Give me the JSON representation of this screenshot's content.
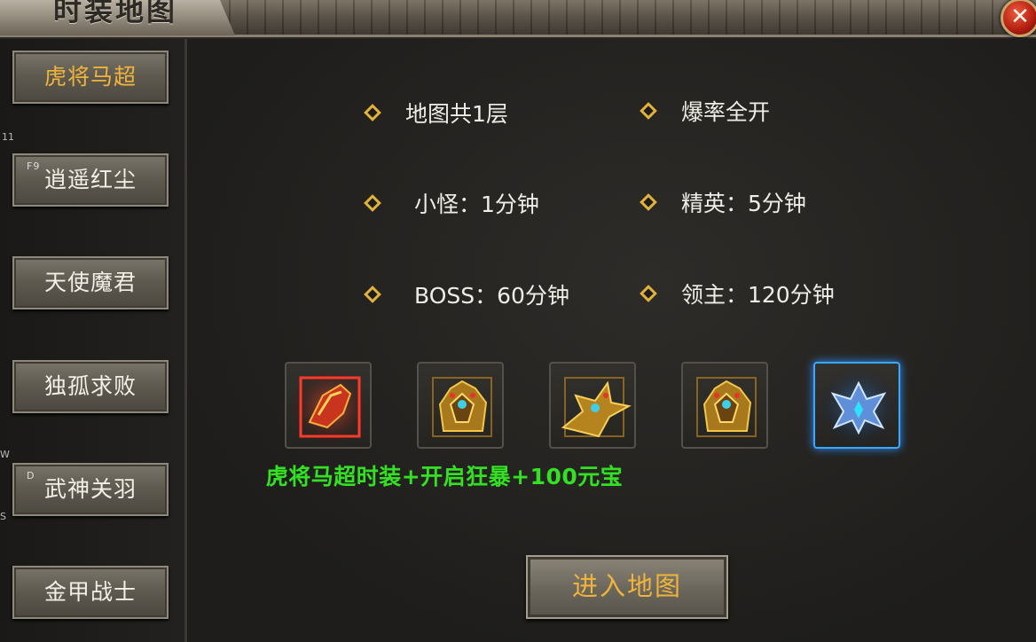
{
  "window": {
    "title": "时装地图"
  },
  "sidebar": {
    "items": [
      {
        "label": "虎将马超",
        "tag": ""
      },
      {
        "label": "逍遥红尘",
        "tag": "F9"
      },
      {
        "label": "天使魔君",
        "tag": ""
      },
      {
        "label": "独孤求败",
        "tag": ""
      },
      {
        "label": "武神关羽",
        "tag": "D"
      },
      {
        "label": "金甲战士",
        "tag": ""
      }
    ],
    "active_index": 0,
    "edge_labels": [
      "11",
      "W",
      "S"
    ]
  },
  "info": [
    {
      "text": "地图共1层"
    },
    {
      "text": "爆率全开"
    },
    {
      "text": "小怪：1分钟"
    },
    {
      "text": "精英：5分钟"
    },
    {
      "text": "BOSS：60分钟"
    },
    {
      "text": "领主：120分钟"
    }
  ],
  "rewards": {
    "items": [
      {
        "icon": "red-gauntlet-icon",
        "frame": "red"
      },
      {
        "icon": "golden-armor-icon",
        "frame": "plain"
      },
      {
        "icon": "golden-dragon-mount-icon",
        "frame": "plain"
      },
      {
        "icon": "golden-armor-icon",
        "frame": "plain"
      },
      {
        "icon": "blue-crystal-wings-icon",
        "frame": "blue"
      }
    ],
    "description": "虎将马超时装+开启狂暴+100元宝"
  },
  "actions": {
    "enter_label": "进入地图"
  },
  "colors": {
    "active_label": "#f0b43b",
    "reward_text": "#33e023",
    "diamond": "#e2b23a",
    "close_button": "#b01e10"
  }
}
